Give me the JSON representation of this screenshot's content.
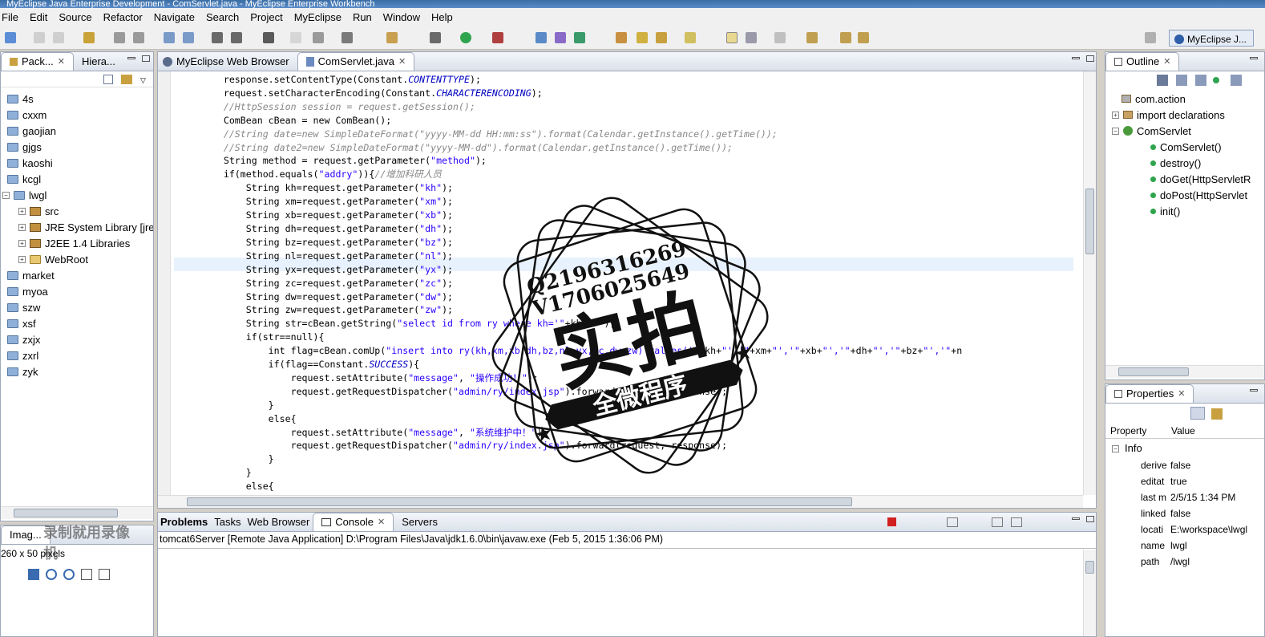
{
  "window": {
    "title": "MyEclipse Java Enterprise Development - ComServlet.java - MyEclipse Enterprise Workbench"
  },
  "menu": [
    "File",
    "Edit",
    "Source",
    "Refactor",
    "Navigate",
    "Search",
    "Project",
    "MyEclipse",
    "Run",
    "Window",
    "Help"
  ],
  "perspective": {
    "label": "MyEclipse J..."
  },
  "package_explorer": {
    "tabs": [
      {
        "label": "Pack..."
      },
      {
        "label": "Hiera..."
      }
    ],
    "items": [
      {
        "label": "4s"
      },
      {
        "label": "cxxm"
      },
      {
        "label": "gaojian"
      },
      {
        "label": "gjgs"
      },
      {
        "label": "kaoshi"
      },
      {
        "label": "kcgl"
      },
      {
        "label": "lwgl"
      },
      {
        "label": "src"
      },
      {
        "label": "JRE System Library [jre"
      },
      {
        "label": "J2EE 1.4 Libraries"
      },
      {
        "label": "WebRoot"
      },
      {
        "label": "market"
      },
      {
        "label": "myoa"
      },
      {
        "label": "szw"
      },
      {
        "label": "xsf"
      },
      {
        "label": "zxjx"
      },
      {
        "label": "zxrl"
      },
      {
        "label": "zyk"
      }
    ]
  },
  "image_panel": {
    "tab": "Imag...",
    "info": "260 x 50 pixels"
  },
  "editor": {
    "tabs": [
      {
        "label": "MyEclipse Web Browser"
      },
      {
        "label": "ComServlet.java"
      }
    ]
  },
  "outline": {
    "tab": "Outline",
    "items": [
      {
        "label": "com.action"
      },
      {
        "label": "import declarations"
      },
      {
        "label": "ComServlet"
      },
      {
        "label": "ComServlet()"
      },
      {
        "label": "destroy()"
      },
      {
        "label": "doGet(HttpServletR"
      },
      {
        "label": "doPost(HttpServlet"
      },
      {
        "label": "init()"
      }
    ]
  },
  "properties": {
    "tab": "Properties",
    "headers": {
      "property": "Property",
      "value": "Value"
    },
    "group": "Info",
    "rows": [
      {
        "key": "derive",
        "value": "false"
      },
      {
        "key": "editat",
        "value": "true"
      },
      {
        "key": "last m",
        "value": "2/5/15 1:34 PM"
      },
      {
        "key": "linked",
        "value": "false"
      },
      {
        "key": "locati",
        "value": "E:\\workspace\\lwgl"
      },
      {
        "key": "name",
        "value": "lwgl"
      },
      {
        "key": "path",
        "value": "/lwgl"
      }
    ]
  },
  "bottom": {
    "tabs": [
      {
        "label": "Problems"
      },
      {
        "label": "Tasks"
      },
      {
        "label": "Web Browser"
      },
      {
        "label": "Console"
      },
      {
        "label": "Servers"
      }
    ],
    "console_line": "tomcat6Server [Remote Java Application] D:\\Program Files\\Java\\jdk1.6.0\\bin\\javaw.exe (Feb 5, 2015 1:36:06 PM)"
  },
  "stamp": {
    "line1": "Q2196316269",
    "line2": "V1706025649",
    "main": "实拍",
    "banner": "全微程序"
  },
  "watermark": {
    "text": "录制就用录像机"
  }
}
